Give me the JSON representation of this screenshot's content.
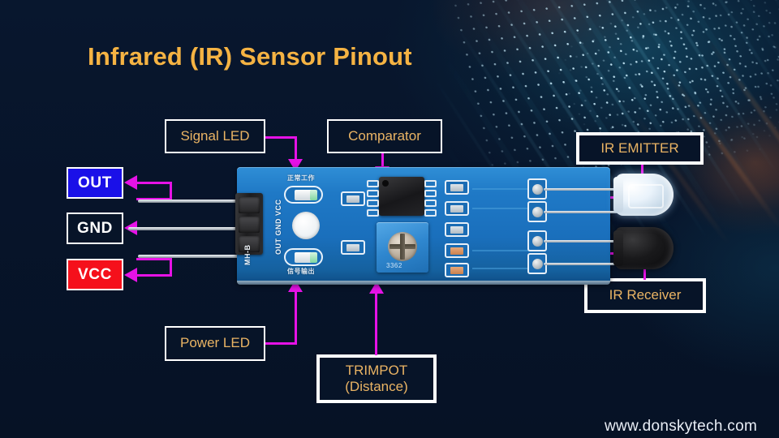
{
  "page": {
    "title": "Infrared (IR) Sensor Pinout",
    "watermark": "www.donskytech.com",
    "background_color": "#071428",
    "accent_color": "#f5b343",
    "connector_color": "#e612e6",
    "label_text_color": "#eab464"
  },
  "callouts": [
    {
      "id": "signal-led",
      "label": "Signal LED"
    },
    {
      "id": "comparator",
      "label": "Comparator"
    },
    {
      "id": "ir-emitter",
      "label": "IR EMITTER"
    },
    {
      "id": "ir-receiver",
      "label": "IR Receiver"
    },
    {
      "id": "power-led",
      "label": "Power LED"
    },
    {
      "id": "trimpot",
      "label_line1": "TRIMPOT",
      "label_line2": "(Distance)"
    }
  ],
  "pins": [
    {
      "id": "out",
      "label": "OUT",
      "box_color": "#1a10e8",
      "text_color": "#ffffff"
    },
    {
      "id": "gnd",
      "label": "GND",
      "box_color": "#071428",
      "text_color": "#ffffff"
    },
    {
      "id": "vcc",
      "label": "VCC",
      "box_color": "#f5101b",
      "text_color": "#ffffff"
    }
  ],
  "board": {
    "silkscreen": {
      "pin_labels": "OUT GND VCC",
      "model": "MH-B",
      "trimpot_marking": "3362",
      "top_marking": "正常工作",
      "bottom_marking": "信号输出"
    }
  }
}
